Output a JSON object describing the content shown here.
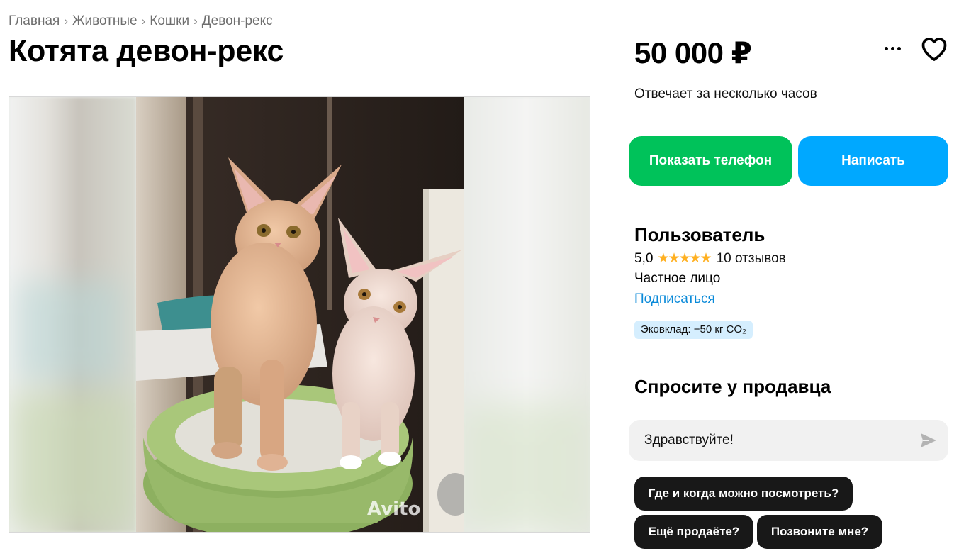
{
  "breadcrumb": [
    "Главная",
    "Животные",
    "Кошки",
    "Девон-рекс"
  ],
  "listing": {
    "title": "Котята девон-рекс",
    "price": "50 000 ₽",
    "watermark": "Avito"
  },
  "seller_response": "Отвечает за несколько часов",
  "actions": {
    "show_phone": "Показать телефон",
    "write": "Написать"
  },
  "seller": {
    "name": "Пользователь",
    "rating": "5,0",
    "stars": "★★★★★",
    "reviews": "10 отзывов",
    "type": "Частное лицо",
    "subscribe": "Подписаться",
    "eco": "Эковклад: −50 кг CO₂"
  },
  "ask": {
    "title": "Спросите у продавца",
    "message": "Здравствуйте!",
    "quick_replies": [
      "Где и когда можно посмотреть?",
      "Ещё продаёте?",
      "Позвоните мне?"
    ]
  },
  "colors": {
    "green_button": "#00c25a",
    "blue_button": "#00a8ff",
    "link": "#0a8ad9",
    "star": "#ffb021",
    "eco_badge": "#d5eefe"
  }
}
